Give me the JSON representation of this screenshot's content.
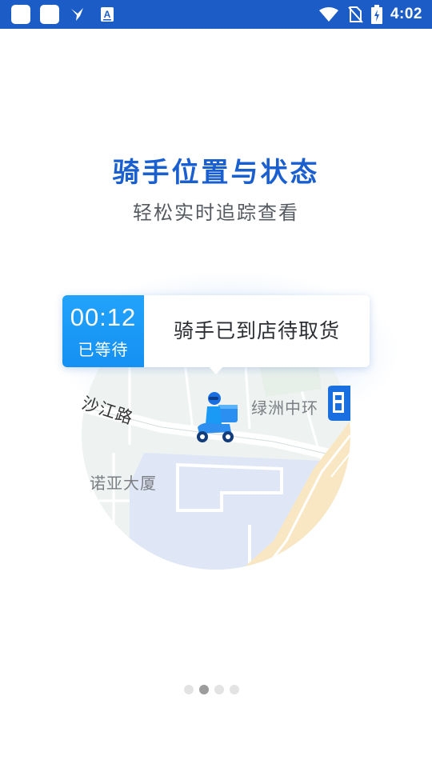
{
  "status_bar": {
    "time": "4:02",
    "left_icons": [
      "app-square-icon",
      "app-square-icon",
      "bird-icon",
      "font-a-icon"
    ],
    "right_icons": [
      "wifi-icon",
      "no-sim-icon",
      "battery-charging-icon"
    ]
  },
  "onboarding": {
    "title": "骑手位置与状态",
    "subtitle": "轻松实时追踪查看"
  },
  "rider_card": {
    "timer": "00:12",
    "timer_label": "已等待",
    "status": "骑手已到店待取货"
  },
  "map": {
    "road_label": "沙江路",
    "place_label_1": "绿洲中环",
    "place_label_2": "诺亚大厦",
    "rider_icon": "scooter-rider-icon",
    "marker_icon": "store-marker-icon"
  },
  "pager": {
    "total_pages": 4,
    "active_index": 1
  },
  "colors": {
    "status_bar": "#1c5cc7",
    "title": "#1a5fd0",
    "timer_bg": "#1a98f6",
    "map_land": "#eef3f2",
    "map_block": "#dfe6f5",
    "map_river": "#f8e7c2"
  }
}
